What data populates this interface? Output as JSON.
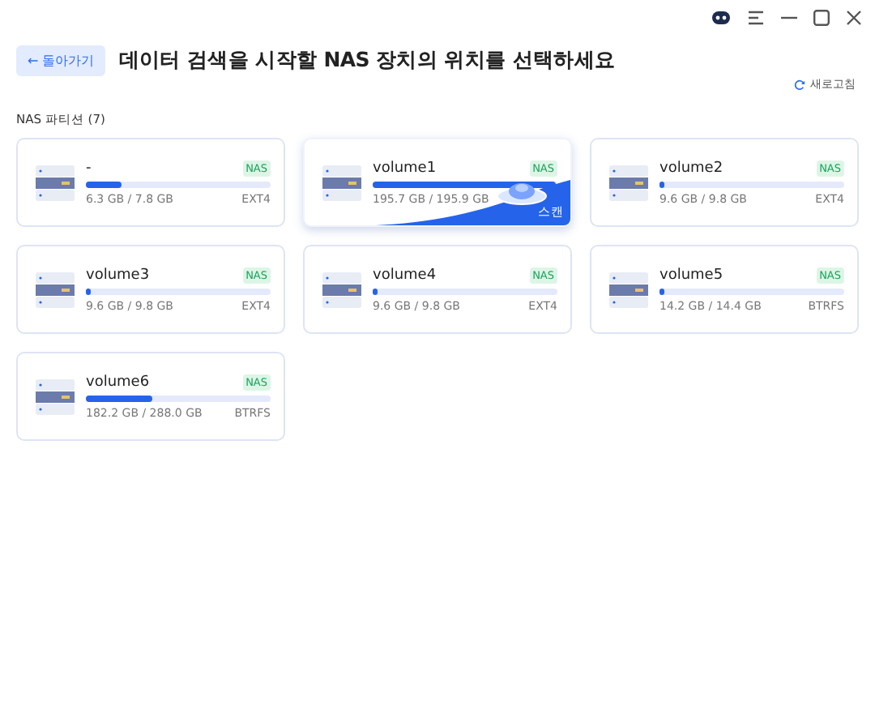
{
  "back_button": {
    "label": "← 돌아가기"
  },
  "title": "데이터 검색을 시작할 NAS 장치의 위치를 선택하세요",
  "refresh": {
    "label": "새로고침"
  },
  "section": {
    "label": "NAS 파티션 (7)"
  },
  "volumes": [
    {
      "name": "-",
      "badge": "NAS",
      "level": 0.19,
      "usage": "6.3 GB / 7.8 GB",
      "fs": "EXT4",
      "hovered": false
    },
    {
      "name": "volume1",
      "badge": "NAS",
      "level": 0.99,
      "usage": "195.7 GB / 195.9 GB",
      "hovered": true,
      "scan_label": "스캔"
    },
    {
      "name": "volume2",
      "badge": "NAS",
      "level": 0.02,
      "usage": "9.6 GB / 9.8 GB",
      "fs": "EXT4",
      "hovered": false
    },
    {
      "name": "volume3",
      "badge": "NAS",
      "level": 0.02,
      "usage": "9.6 GB / 9.8 GB",
      "fs": "EXT4",
      "hovered": false
    },
    {
      "name": "volume4",
      "badge": "NAS",
      "level": 0.02,
      "usage": "9.6 GB / 9.8 GB",
      "fs": "EXT4",
      "hovered": false
    },
    {
      "name": "volume5",
      "badge": "NAS",
      "level": 0.02,
      "usage": "14.2 GB / 14.4 GB",
      "fs": "BTRFS",
      "hovered": false
    },
    {
      "name": "volume6",
      "badge": "NAS",
      "level": 0.36,
      "usage": "182.2 GB / 288.0 GB",
      "fs": "BTRFS",
      "hovered": false
    }
  ]
}
